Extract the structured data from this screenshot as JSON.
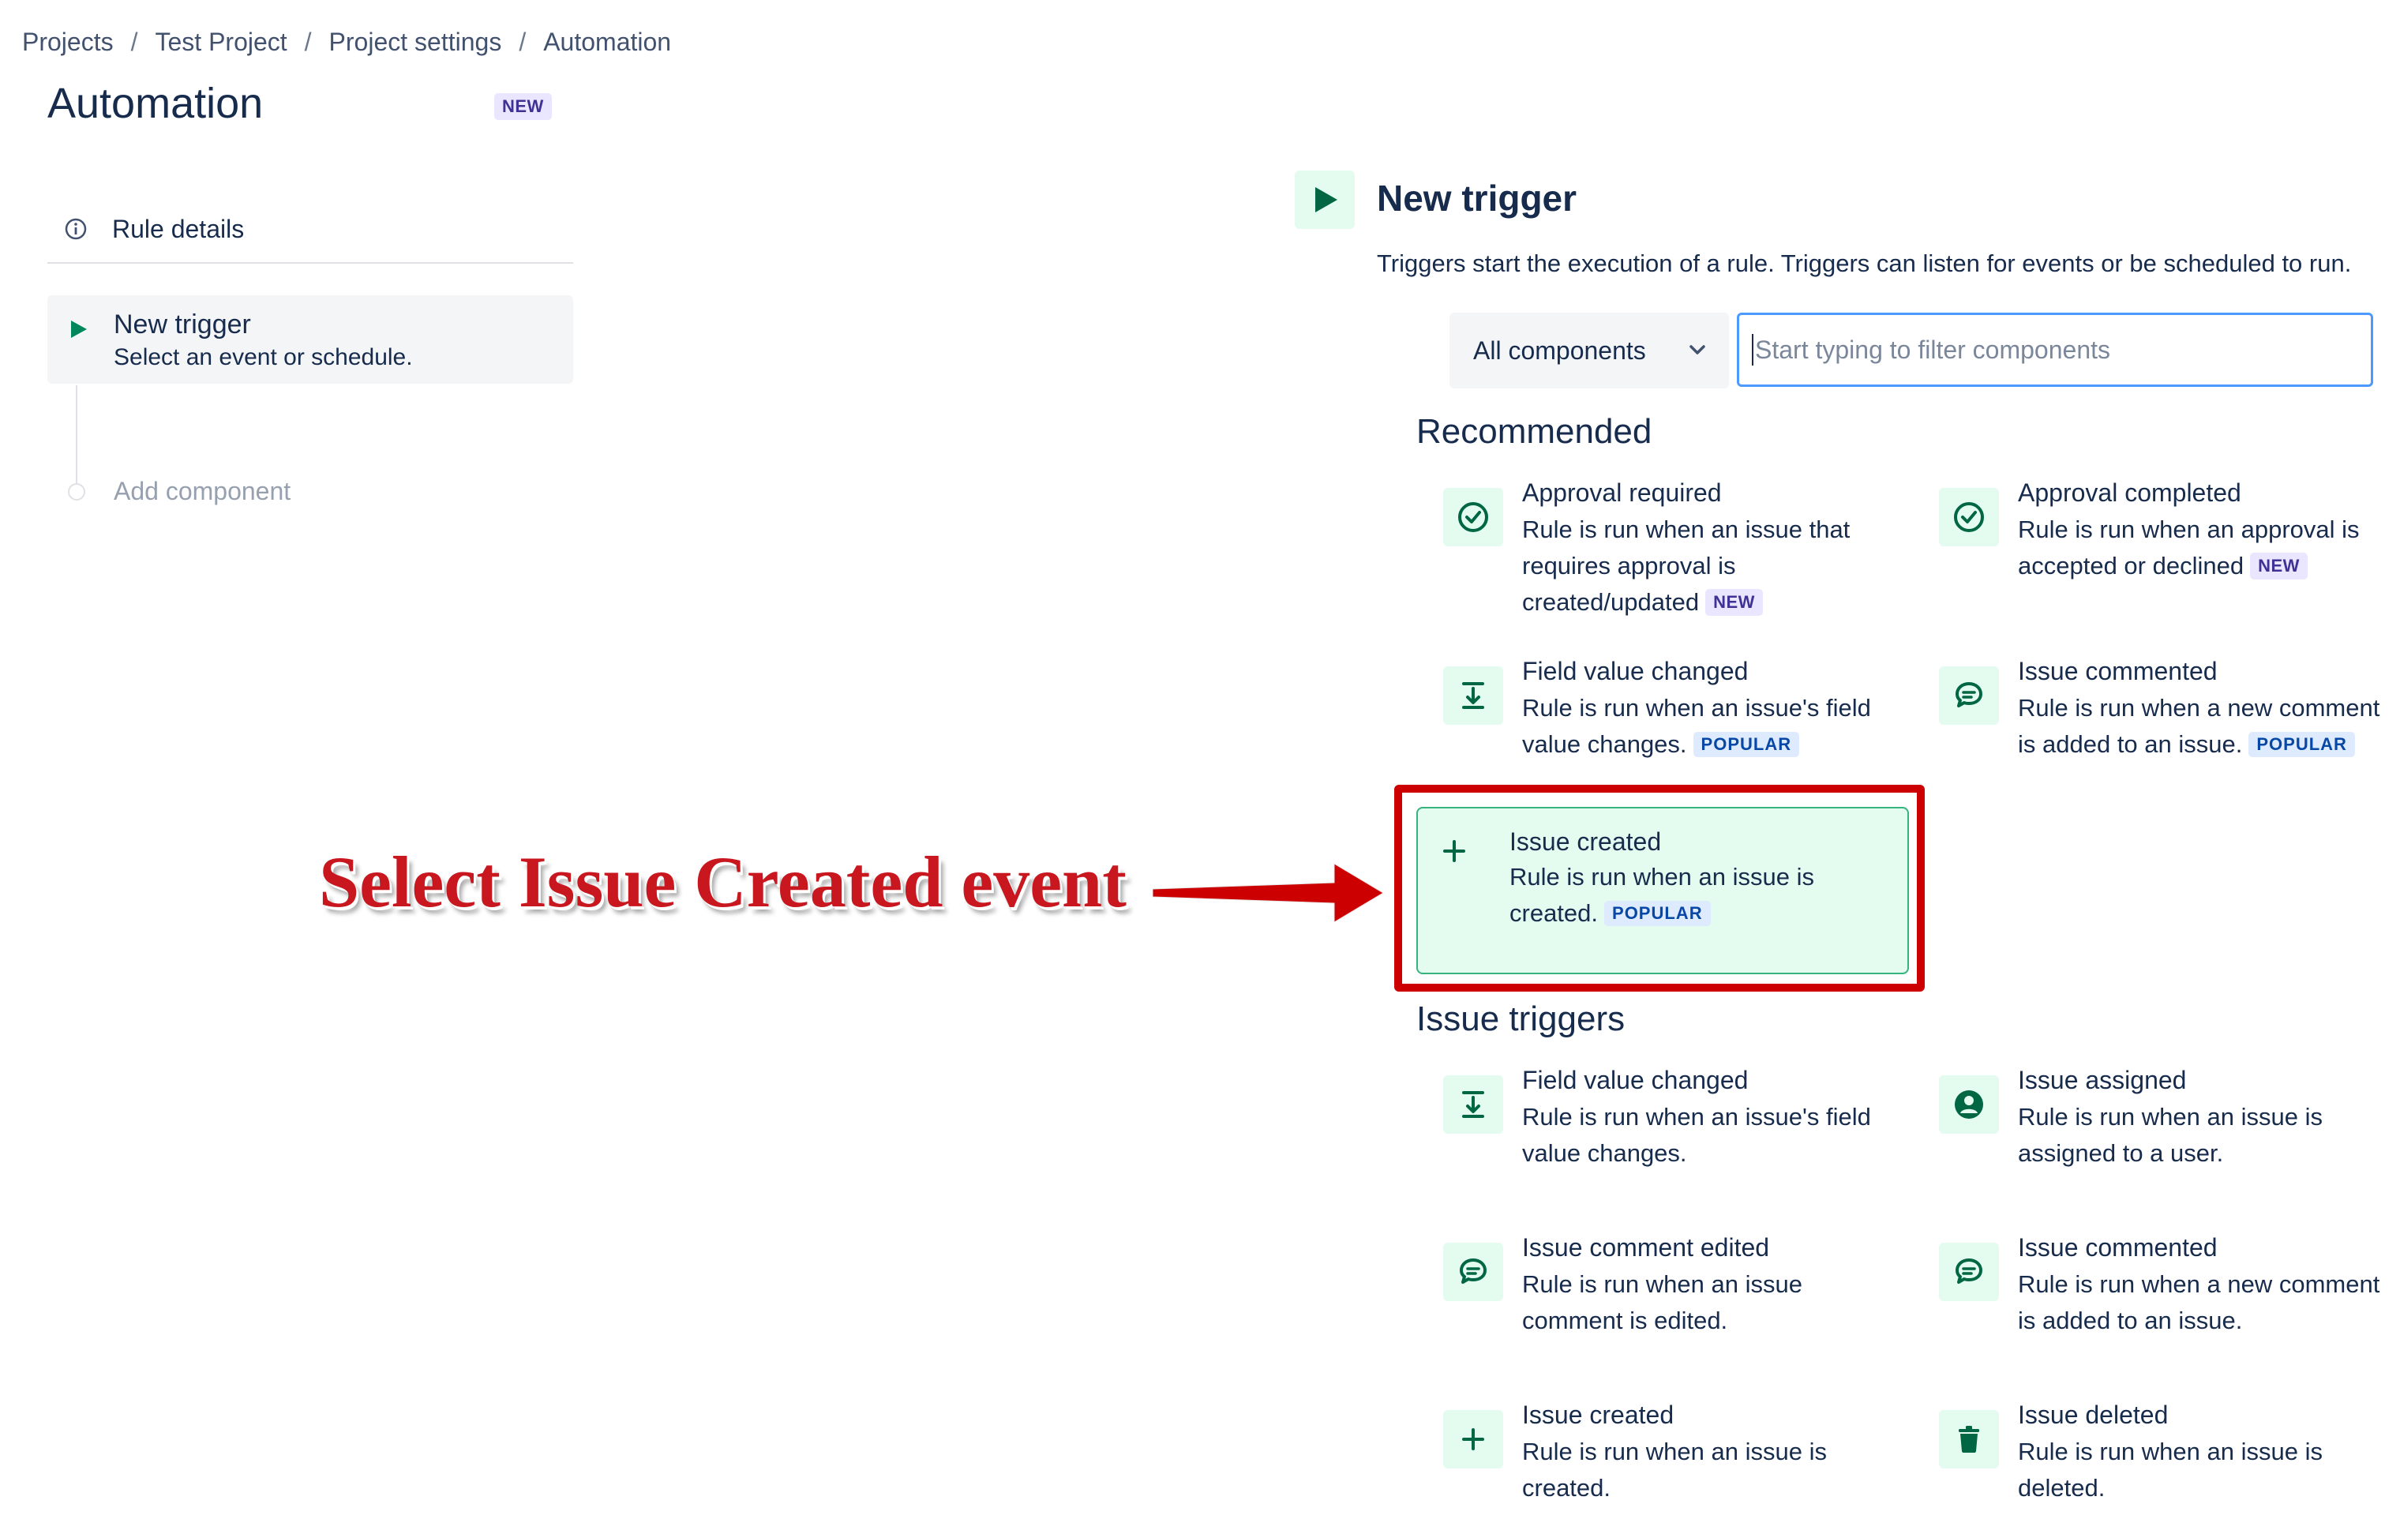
{
  "breadcrumb": [
    "Projects",
    "Test Project",
    "Project settings",
    "Automation"
  ],
  "breadcrumb_sep": "/",
  "page": {
    "title": "Automation",
    "badge": "NEW"
  },
  "sidebar": {
    "rule_details": "Rule details",
    "step_trigger": {
      "title": "New trigger",
      "subtitle": "Select an event or schedule."
    },
    "add_component": "Add component"
  },
  "trigger": {
    "title": "New trigger",
    "description": "Triggers start the execution of a rule. Triggers can listen for events or be scheduled to run.",
    "component_select": "All components",
    "filter_placeholder": "Start typing to filter components"
  },
  "recommended": {
    "title": "Recommended",
    "items": [
      {
        "title": "Approval required",
        "desc": "Rule is run when an issue that requires approval is created/updated",
        "badge": "NEW",
        "icon": "check-circle-icon"
      },
      {
        "title": "Approval completed",
        "desc": "Rule is run when an approval is accepted or declined",
        "badge": "NEW",
        "icon": "check-circle-icon"
      },
      {
        "title": "Field value changed",
        "desc": "Rule is run when an issue's field value changes.",
        "badge": "POPULAR",
        "icon": "field-change-icon"
      },
      {
        "title": "Issue commented",
        "desc": "Rule is run when a new comment is added to an issue.",
        "badge": "POPULAR",
        "icon": "comment-icon"
      },
      {
        "title": "Issue created",
        "desc": "Rule is run when an issue is created.",
        "badge": "POPULAR",
        "icon": "plus-icon"
      }
    ]
  },
  "issue_triggers": {
    "title": "Issue triggers",
    "items": [
      {
        "title": "Field value changed",
        "desc": "Rule is run when an issue's field value changes.",
        "icon": "field-change-icon"
      },
      {
        "title": "Issue assigned",
        "desc": "Rule is run when an issue is assigned to a user.",
        "icon": "user-icon"
      },
      {
        "title": "Issue comment edited",
        "desc": "Rule is run when an issue comment is edited.",
        "icon": "comment-icon"
      },
      {
        "title": "Issue commented",
        "desc": "Rule is run when a new comment is added to an issue.",
        "icon": "comment-icon"
      },
      {
        "title": "Issue created",
        "desc": "Rule is run when an issue is created.",
        "icon": "plus-icon"
      },
      {
        "title": "Issue deleted",
        "desc": "Rule is run when an issue is deleted.",
        "icon": "trash-icon"
      }
    ]
  },
  "annotation": "Select Issue Created event",
  "colors": {
    "accent_green": "#00875a",
    "card_bg": "#e3fcef",
    "highlight_red": "#cc0000",
    "focus_blue": "#4c9aff"
  }
}
